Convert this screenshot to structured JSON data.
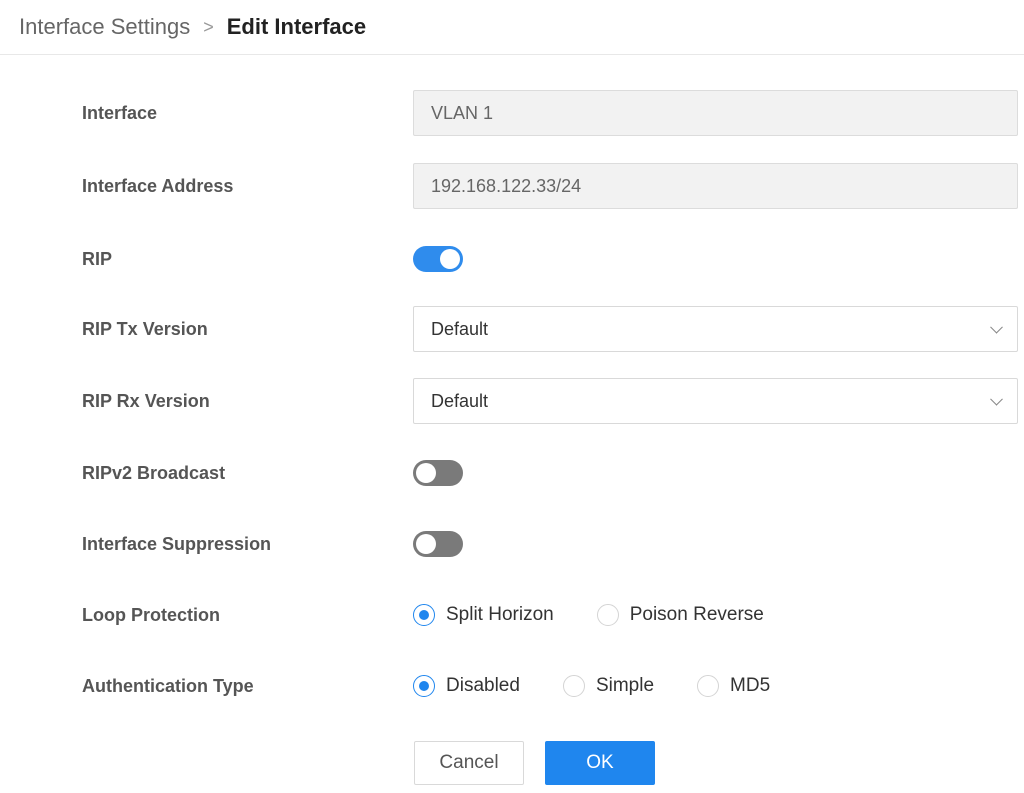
{
  "breadcrumb": {
    "parent": "Interface Settings",
    "separator": ">",
    "current": "Edit Interface"
  },
  "form": {
    "interface": {
      "label": "Interface",
      "value": "VLAN 1"
    },
    "interface_address": {
      "label": "Interface Address",
      "value": "192.168.122.33/24"
    },
    "rip": {
      "label": "RIP",
      "enabled": true
    },
    "rip_tx_version": {
      "label": "RIP Tx Version",
      "value": "Default"
    },
    "rip_rx_version": {
      "label": "RIP Rx Version",
      "value": "Default"
    },
    "ripv2_broadcast": {
      "label": "RIPv2 Broadcast",
      "enabled": false
    },
    "interface_suppression": {
      "label": "Interface Suppression",
      "enabled": false
    },
    "loop_protection": {
      "label": "Loop Protection",
      "options": [
        "Split Horizon",
        "Poison Reverse"
      ],
      "selected": "Split Horizon"
    },
    "authentication_type": {
      "label": "Authentication Type",
      "options": [
        "Disabled",
        "Simple",
        "MD5"
      ],
      "selected": "Disabled"
    }
  },
  "actions": {
    "cancel_label": "Cancel",
    "ok_label": "OK"
  },
  "colors": {
    "accent": "#1f86ee",
    "toggle_on": "#2f8ced",
    "toggle_off": "#7a7a7a"
  }
}
